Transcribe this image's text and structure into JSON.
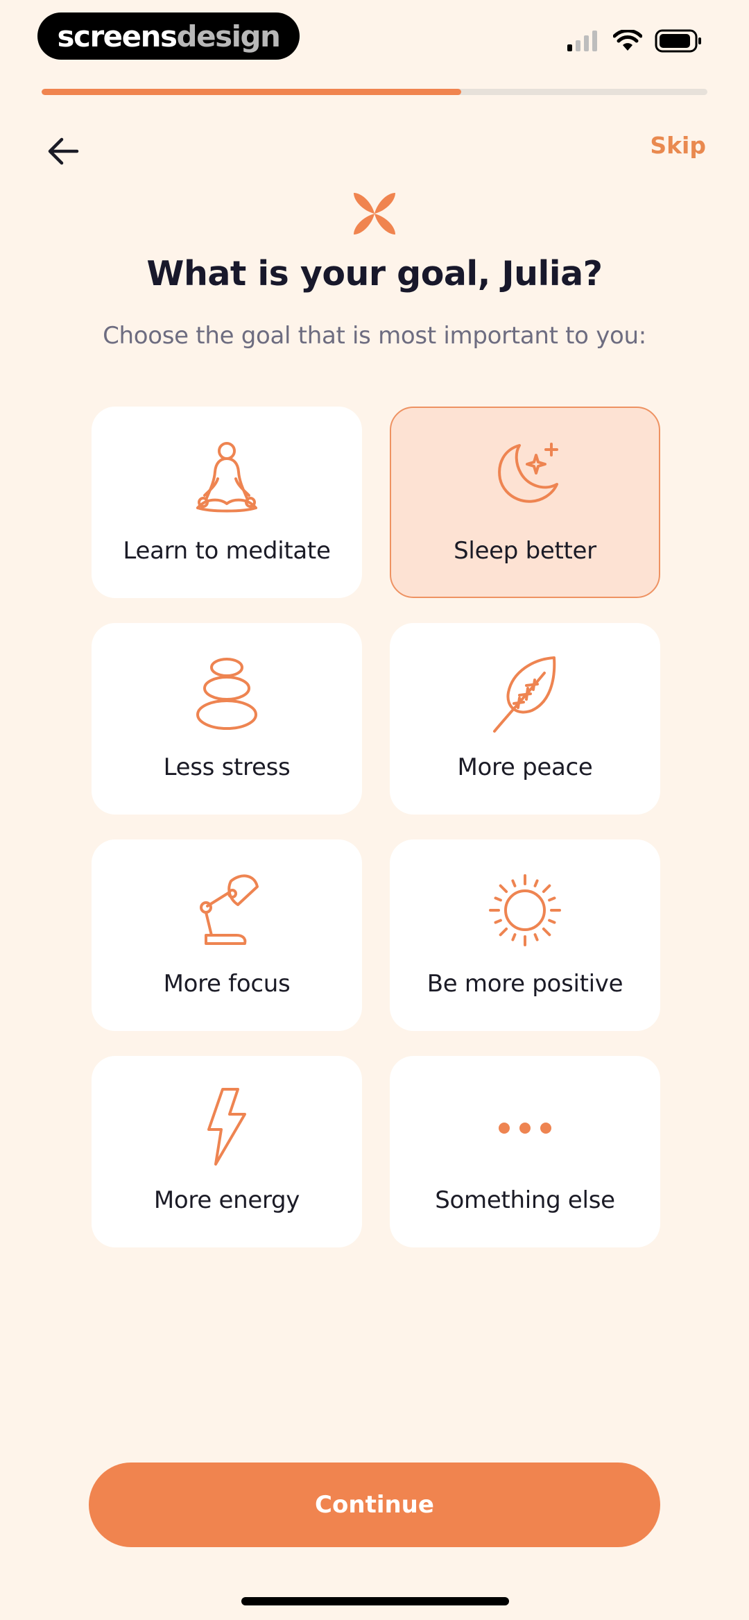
{
  "status_bar": {
    "brand_part1": "screens",
    "brand_part2": "design"
  },
  "progress": {
    "value": 0.63
  },
  "nav": {
    "skip_label": "Skip"
  },
  "header": {
    "title": "What is your goal, Julia?",
    "subtitle": "Choose the goal that is most important to you:"
  },
  "goals": [
    {
      "label": "Learn to meditate",
      "icon": "meditation-icon",
      "selected": false
    },
    {
      "label": "Sleep better",
      "icon": "moon-stars-icon",
      "selected": true
    },
    {
      "label": "Less stress",
      "icon": "stacked-stones-icon",
      "selected": false
    },
    {
      "label": "More peace",
      "icon": "leaf-icon",
      "selected": false
    },
    {
      "label": "More focus",
      "icon": "desk-lamp-icon",
      "selected": false
    },
    {
      "label": "Be more positive",
      "icon": "sun-icon",
      "selected": false
    },
    {
      "label": "More energy",
      "icon": "lightning-icon",
      "selected": false
    },
    {
      "label": "Something else",
      "icon": "more-dots-icon",
      "selected": false
    }
  ],
  "continue_label": "Continue",
  "colors": {
    "accent": "#F0844F",
    "background": "#FEF4EA",
    "selected_card": "#FDE2D3",
    "title": "#18182B"
  }
}
